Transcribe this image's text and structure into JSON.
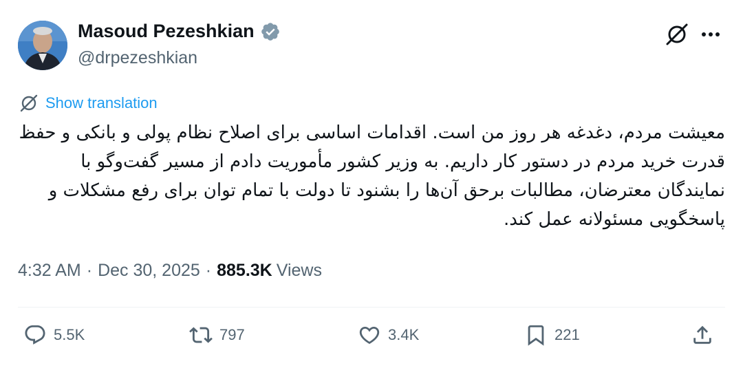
{
  "author": {
    "name": "Masoud Pezeshkian",
    "handle": "@drpezeshkian",
    "verified_color": "#829aab"
  },
  "translation": {
    "label": "Show translation"
  },
  "tweet": {
    "text": "معیشت مردم، دغدغه هر روز من است. اقدامات اساسی برای اصلاح نظام پولی و بانکی و حفظ قدرت خرید مردم در دستور کار داریم. به وزیر کشور مأموریت دادم از مسیر گفت‌وگو با نمایندگان معترضان، مطالبات برحق آن‌ها را بشنود تا دولت با تمام توان برای رفع مشکلات و پاسخگویی مسئولانه عمل کند."
  },
  "meta": {
    "time": "4:32 AM",
    "date": "Dec 30, 2025",
    "views_count": "885.3K",
    "views_label": "Views"
  },
  "actions": {
    "replies": "5.5K",
    "reposts": "797",
    "likes": "3.4K",
    "bookmarks": "221"
  },
  "icons": [
    "grok-icon",
    "more-icon",
    "translate-icon",
    "reply-icon",
    "repost-icon",
    "like-icon",
    "bookmark-icon",
    "share-icon",
    "verified-badge-icon"
  ],
  "colors": {
    "link": "#1d9bf0",
    "secondary": "#536471",
    "primary": "#0f1419"
  }
}
